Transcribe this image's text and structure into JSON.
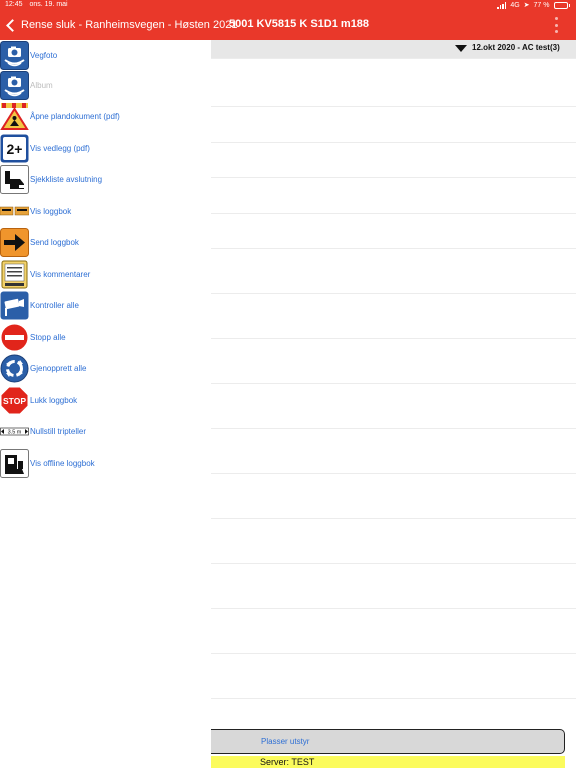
{
  "status_bar": {
    "time": "12:45",
    "date": "ons. 19. mai",
    "network": "4G",
    "battery": "77 %",
    "battery_level": 0.77
  },
  "header": {
    "back_label": "Rense sluk - Ranheimsvegen - Høsten 2021",
    "title": "5001 KV5815 K S1D1 m188",
    "color": "#e9382a"
  },
  "menu": [
    {
      "label": "Vegfoto",
      "icon": "camera-sign-icon",
      "enabled": true
    },
    {
      "label": "Album",
      "icon": "camera-album-icon",
      "enabled": false
    },
    {
      "label": "Åpne plandokument (pdf)",
      "icon": "roadwork-sign-icon",
      "enabled": true
    },
    {
      "label": "Vis vedlegg (pdf)",
      "icon": "two-plus-sign-icon",
      "enabled": true
    },
    {
      "label": "Sjekkliste avslutning",
      "icon": "checklist-sign-icon",
      "enabled": true
    },
    {
      "label": "Vis loggbok",
      "icon": "logbook-sign-icon",
      "enabled": true
    },
    {
      "label": "Send loggbok",
      "icon": "arrow-right-sign-icon",
      "enabled": true
    },
    {
      "label": "Vis kommentarer",
      "icon": "comment-sign-icon",
      "enabled": true
    },
    {
      "label": "Kontroller alle",
      "icon": "camera-control-sign-icon",
      "enabled": true
    },
    {
      "label": "Stopp alle",
      "icon": "no-entry-sign-icon",
      "enabled": true
    },
    {
      "label": "Gjenopprett alle",
      "icon": "roundabout-sign-icon",
      "enabled": true
    },
    {
      "label": "Lukk loggbok",
      "icon": "stop-sign-icon",
      "enabled": true
    },
    {
      "label": "Nullstill tripteller",
      "icon": "distance-sign-icon",
      "enabled": true
    },
    {
      "label": "Vis offline loggbok",
      "icon": "offline-sign-icon",
      "enabled": true
    }
  ],
  "icon_text": {
    "two_plus": "2+",
    "stop": "STOP",
    "distance": "3.5 m"
  },
  "filter": {
    "label": "12.okt 2020 - AC test(3)"
  },
  "footer": {
    "place_button": "Plasser utstyr",
    "server": "Server: TEST",
    "server_color": "#fbfb5c"
  }
}
